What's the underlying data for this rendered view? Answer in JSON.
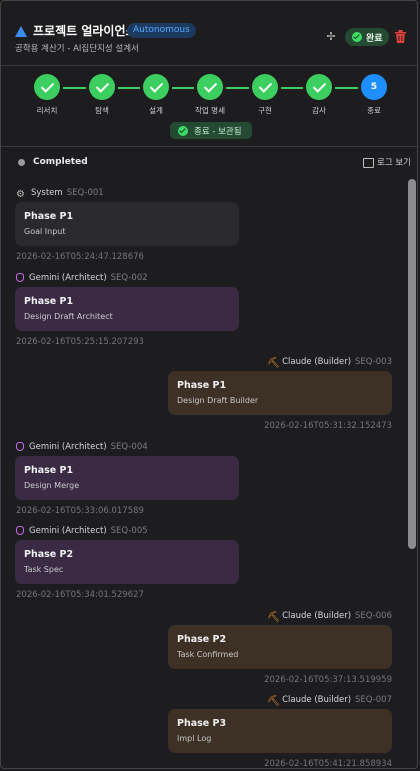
{
  "header": {
    "title": "프로젝트 얼라이언스",
    "mode_badge": "Autonomous",
    "subtitle": "공학용 계산기 - AI집단지성 설계서",
    "done_label": "완료",
    "icons": [
      "triangle-logo-icon",
      "sparkle-icon",
      "check-circle-icon",
      "trash-icon"
    ],
    "accent_color": "#3b8cf0",
    "delete_color": "#e0443a"
  },
  "stepper": {
    "steps": [
      {
        "label": "리서치",
        "state": "done"
      },
      {
        "label": "탐색",
        "state": "done"
      },
      {
        "label": "설계",
        "state": "done"
      },
      {
        "label": "작업 명세",
        "state": "done"
      },
      {
        "label": "구현",
        "state": "done"
      },
      {
        "label": "감사",
        "state": "done"
      },
      {
        "label": "종료",
        "state": "current",
        "number": "5"
      }
    ],
    "saved_label": "종료 - 보관됨",
    "done_color": "#3ccf5f",
    "current_color": "#1e8fff"
  },
  "status": {
    "text": "Completed",
    "log_button": "로그 보기"
  },
  "messages": [
    {
      "sender": "System",
      "seq": "SEQ-001",
      "phase": "Phase P1",
      "desc": "Goal Input",
      "timestamp": "2026-02-16T05:24:47.128676",
      "side": "left",
      "kind": "system"
    },
    {
      "sender": "Gemini (Architect)",
      "seq": "SEQ-002",
      "phase": "Phase P1",
      "desc": "Design Draft Architect",
      "timestamp": "2026-02-16T05:25:15.207293",
      "side": "left",
      "kind": "gemini"
    },
    {
      "sender": "Claude (Builder)",
      "seq": "SEQ-003",
      "phase": "Phase P1",
      "desc": "Design Draft Builder",
      "timestamp": "2026-02-16T05:31:32.152473",
      "side": "right",
      "kind": "claude"
    },
    {
      "sender": "Gemini (Architect)",
      "seq": "SEQ-004",
      "phase": "Phase P1",
      "desc": "Design Merge",
      "timestamp": "2026-02-16T05:33:06.017589",
      "side": "left",
      "kind": "gemini"
    },
    {
      "sender": "Gemini (Architect)",
      "seq": "SEQ-005",
      "phase": "Phase P2",
      "desc": "Task Spec",
      "timestamp": "2026-02-16T05:34:01.529627",
      "side": "left",
      "kind": "gemini"
    },
    {
      "sender": "Claude (Builder)",
      "seq": "SEQ-006",
      "phase": "Phase P2",
      "desc": "Task Confirmed",
      "timestamp": "2026-02-16T05:37:13.519959",
      "side": "right",
      "kind": "claude"
    },
    {
      "sender": "Claude (Builder)",
      "seq": "SEQ-007",
      "phase": "Phase P3",
      "desc": "Impl Log",
      "timestamp": "2026-02-16T05:41:21.858934",
      "side": "right",
      "kind": "claude"
    }
  ]
}
